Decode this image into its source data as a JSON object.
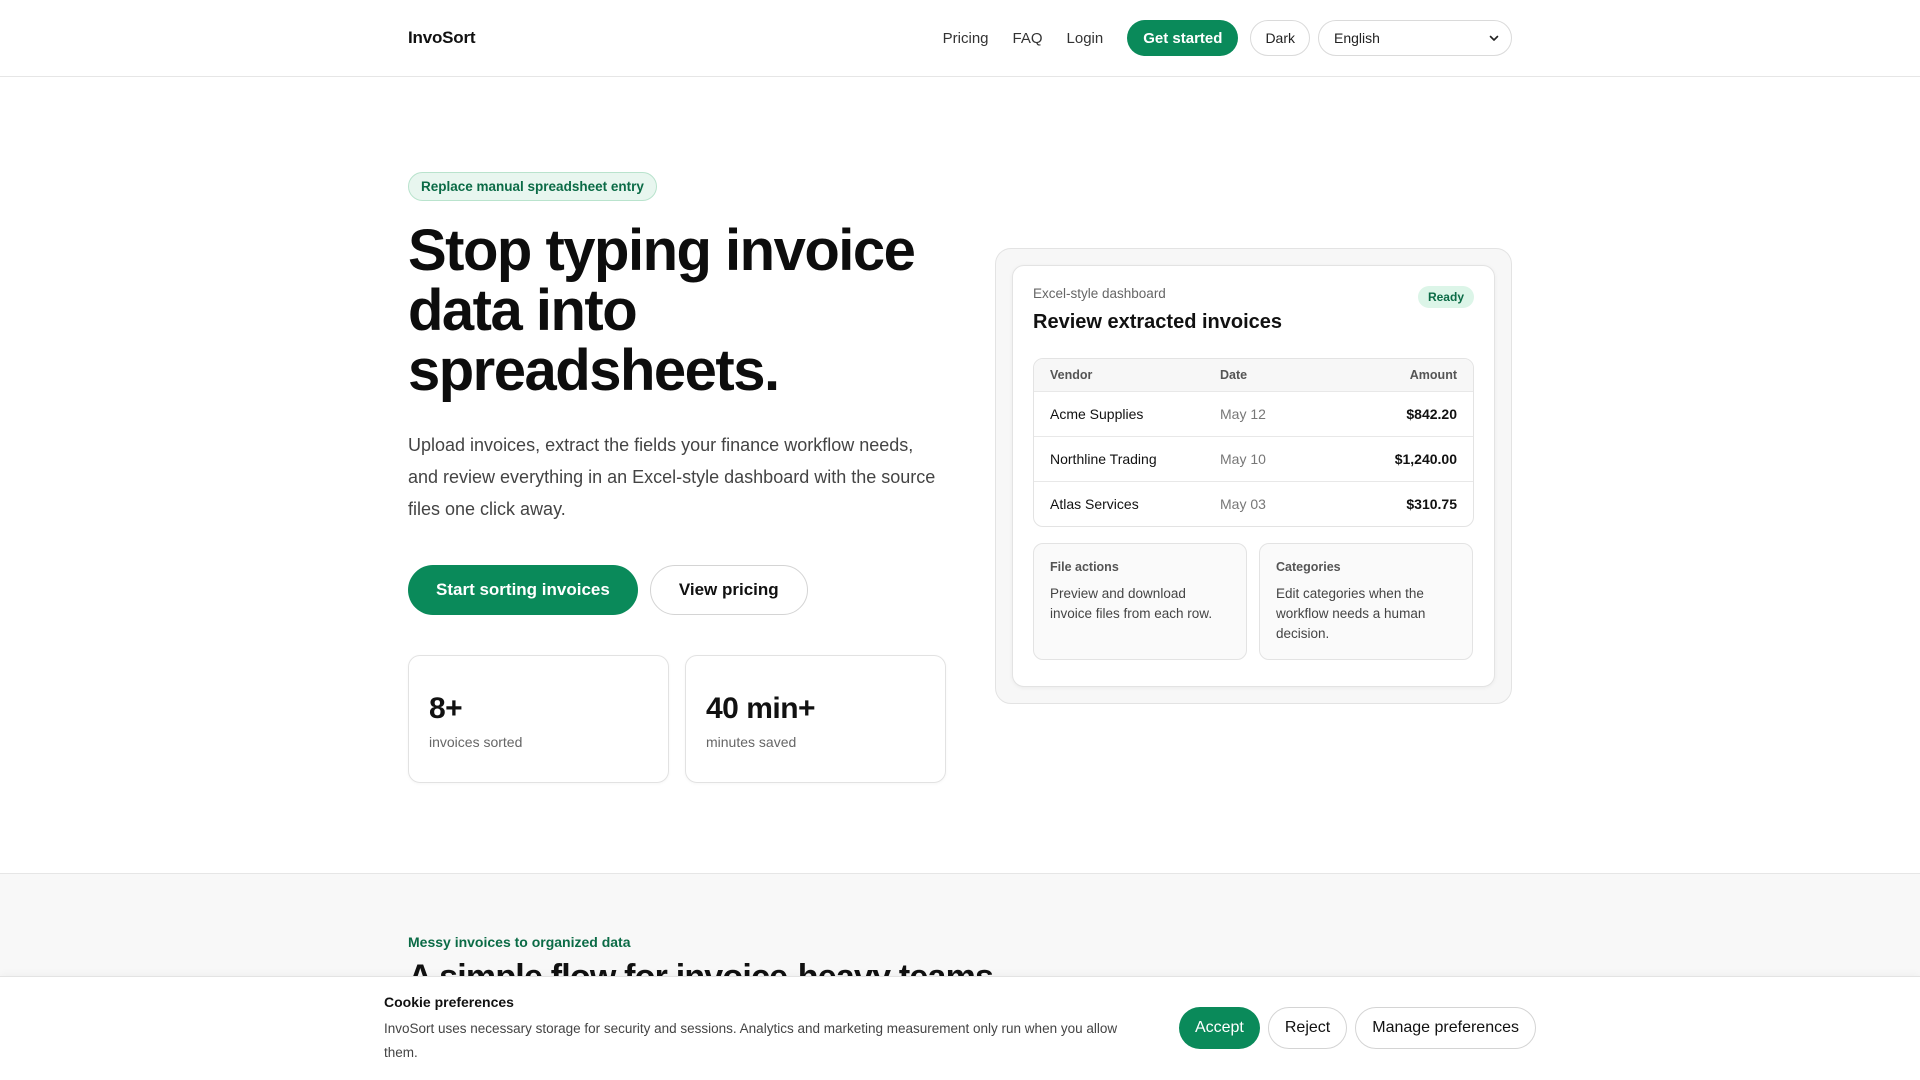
{
  "brand": {
    "name": "InvoSort",
    "accent": "#0a8a5a"
  },
  "nav": {
    "links": [
      "Pricing",
      "FAQ",
      "Login"
    ],
    "cta": "Get started",
    "theme_toggle": "Dark",
    "language": "English"
  },
  "hero": {
    "tag": "Replace manual spreadsheet entry",
    "title": "Stop typing invoice data into spreadsheets.",
    "subtitle": "Upload invoices, extract the fields your finance workflow needs, and review everything in an Excel-style dashboard with the source files one click away.",
    "primary_cta": "Start sorting invoices",
    "secondary_cta": "View pricing",
    "stats": [
      {
        "value": "8+",
        "label": "invoices sorted"
      },
      {
        "value": "40 min+",
        "label": "minutes saved"
      }
    ]
  },
  "dashboard": {
    "kicker": "Excel-style dashboard",
    "title": "Review extracted invoices",
    "badge": "Ready",
    "columns": {
      "vendor": "Vendor",
      "date": "Date",
      "amount": "Amount"
    },
    "rows": [
      {
        "vendor": "Acme Supplies",
        "date": "May 12",
        "amount": "$842.20"
      },
      {
        "vendor": "Northline Trading",
        "date": "May 10",
        "amount": "$1,240.00"
      },
      {
        "vendor": "Atlas Services",
        "date": "May 03",
        "amount": "$310.75"
      }
    ],
    "cards": [
      {
        "title": "File actions",
        "text": "Preview and download invoice files from each row."
      },
      {
        "title": "Categories",
        "text": "Edit categories when the workflow needs a human decision."
      }
    ]
  },
  "section2": {
    "kicker": "Messy invoices to organized data",
    "title": "A simple flow for invoice-heavy teams"
  },
  "cookie": {
    "title": "Cookie preferences",
    "text": "InvoSort uses necessary storage for security and sessions. Analytics and marketing measurement only run when you allow them.",
    "accept": "Accept",
    "reject": "Reject",
    "manage": "Manage preferences"
  }
}
